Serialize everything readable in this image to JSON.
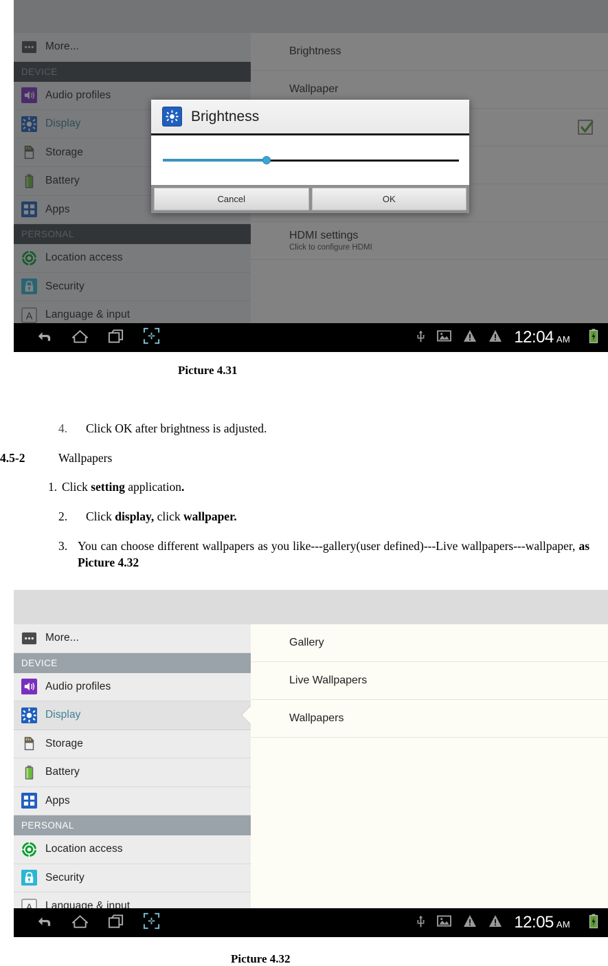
{
  "document": {
    "caption_top": "Picture 4.31",
    "caption_bottom": "Picture 4.32",
    "step4_num": "4.",
    "step4_text": "Click OK after brightness is adjusted.",
    "section_number": "4.5-2",
    "section_title": "Wallpapers",
    "item1_num": "1.",
    "item1_a": "Click ",
    "item1_b": "setting",
    "item1_c": " application",
    "item1_d": ".",
    "item2_num": "2.",
    "item2_a": "Click ",
    "item2_b": "display,",
    "item2_c": " click ",
    "item2_d": "wallpaper.",
    "item3_num": "3.",
    "item3_a": "You can choose different wallpapers as you like---gallery(user defined)---Live wallpapers---wallpaper, ",
    "item3_b": "as Picture 4.32"
  },
  "screenshot1": {
    "sidebar": [
      {
        "label": "More...",
        "icon": "more-icon",
        "type": "item",
        "icon_color": "#4a4a4a"
      },
      {
        "label": "DEVICE",
        "icon": "",
        "type": "header"
      },
      {
        "label": "Audio profiles",
        "icon": "speaker-icon",
        "type": "item",
        "icon_color": "#7b2fbf"
      },
      {
        "label": "Display",
        "icon": "brightness-icon",
        "type": "item",
        "icon_color": "#1f5fbd",
        "selected": true
      },
      {
        "label": "Storage",
        "icon": "sdcard-icon",
        "type": "item",
        "icon_color": "#555555"
      },
      {
        "label": "Battery",
        "icon": "battery-icon",
        "type": "item",
        "icon_color": "#6cbb3c"
      },
      {
        "label": "Apps",
        "icon": "apps-grid-icon",
        "type": "item",
        "icon_color": "#1f5fbd"
      },
      {
        "label": "PERSONAL",
        "icon": "",
        "type": "header"
      },
      {
        "label": "Location access",
        "icon": "location-target-icon",
        "type": "item",
        "icon_color": "#0f9d2f"
      },
      {
        "label": "Security",
        "icon": "lock-icon",
        "type": "item",
        "icon_color": "#2bb6d4"
      },
      {
        "label": "Language & input",
        "icon": "letter-a-icon",
        "type": "item",
        "icon_color": "#888888"
      }
    ],
    "content": [
      {
        "title": "Brightness",
        "subtitle": "",
        "check": false
      },
      {
        "title": "Wallpaper",
        "subtitle": "",
        "check": false
      },
      {
        "title": "",
        "subtitle": "",
        "check": true
      },
      {
        "title": "",
        "subtitle": "",
        "check": false
      },
      {
        "title": "",
        "subtitle": "",
        "check": false
      },
      {
        "title": "HDMI settings",
        "subtitle": "Click to configure HDMI",
        "check": false
      }
    ],
    "dialog": {
      "title": "Brightness",
      "icon": "brightness-icon",
      "cancel_label": "Cancel",
      "ok_label": "OK",
      "slider_percent": 35
    },
    "navbar": {
      "time": "12:04",
      "ampm": "AM",
      "back": "back-icon",
      "home": "home-icon",
      "recents": "recents-icon",
      "screenshot": "screenshot-icon",
      "usb": "usb-icon",
      "image": "image-icon",
      "warning1": "warning-icon",
      "warning2": "warning-icon",
      "battery": "battery-charging-icon"
    }
  },
  "screenshot2": {
    "sidebar": [
      {
        "label": "More...",
        "icon": "more-icon",
        "type": "item",
        "icon_color": "#4a4a4a"
      },
      {
        "label": "DEVICE",
        "icon": "",
        "type": "header"
      },
      {
        "label": "Audio profiles",
        "icon": "speaker-icon",
        "type": "item",
        "icon_color": "#7b2fbf"
      },
      {
        "label": "Display",
        "icon": "brightness-icon",
        "type": "item",
        "icon_color": "#1f5fbd",
        "selected": true
      },
      {
        "label": "Storage",
        "icon": "sdcard-icon",
        "type": "item",
        "icon_color": "#555555"
      },
      {
        "label": "Battery",
        "icon": "battery-icon",
        "type": "item",
        "icon_color": "#6cbb3c"
      },
      {
        "label": "Apps",
        "icon": "apps-grid-icon",
        "type": "item",
        "icon_color": "#1f5fbd"
      },
      {
        "label": "PERSONAL",
        "icon": "",
        "type": "header"
      },
      {
        "label": "Location access",
        "icon": "location-target-icon",
        "type": "item",
        "icon_color": "#0f9d2f"
      },
      {
        "label": "Security",
        "icon": "lock-icon",
        "type": "item",
        "icon_color": "#2bb6d4"
      },
      {
        "label": "Language & input",
        "icon": "letter-a-icon",
        "type": "item",
        "icon_color": "#888888"
      }
    ],
    "content": [
      {
        "title": "Gallery"
      },
      {
        "title": "Live Wallpapers"
      },
      {
        "title": "Wallpapers"
      }
    ],
    "navbar": {
      "time": "12:05",
      "ampm": "AM",
      "back": "back-icon",
      "home": "home-icon",
      "recents": "recents-icon",
      "screenshot": "screenshot-icon",
      "usb": "usb-icon",
      "image": "image-icon",
      "warning1": "warning-icon",
      "warning2": "warning-icon",
      "battery": "battery-charging-icon"
    }
  },
  "colors": {
    "accent_blue": "#1f5fbd",
    "slider_blue": "#3a93c0",
    "selected_text": "#3f7f93",
    "sidebar_bg": "#ececec",
    "content_bg": "#fdfdf5",
    "group_header_bg": "#9aa3aa",
    "navbar_bg": "#000000",
    "check_green": "#5a9e28"
  }
}
